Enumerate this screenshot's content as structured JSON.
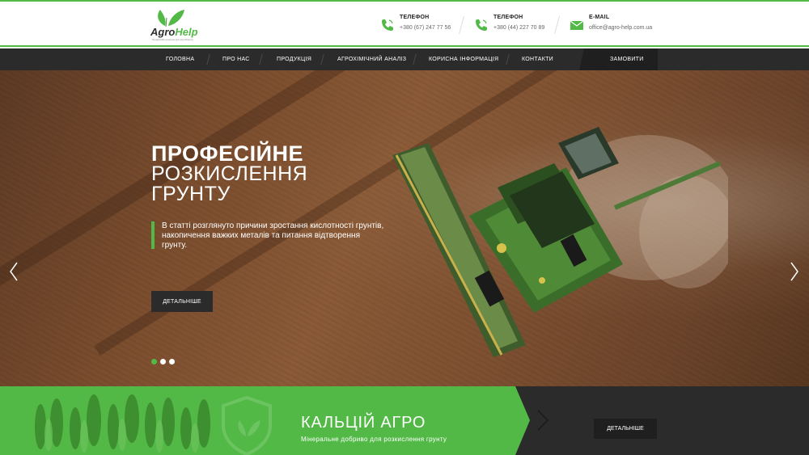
{
  "brand": {
    "name_part1": "Agro",
    "name_part2": "Help",
    "tagline": "Професійні рішення для агробізнесу"
  },
  "contacts": [
    {
      "label": "ТЕЛЕФОН",
      "value": "+380 (67) 247 77 56",
      "icon": "phone-icon"
    },
    {
      "label": "ТЕЛЕФОН",
      "value": "+380 (44) 227 70 89",
      "icon": "phone-icon"
    },
    {
      "label": "E-MAIL",
      "value": "office@agro-help.com.ua",
      "icon": "mail-icon"
    }
  ],
  "nav": {
    "items": [
      "ГОЛОВНА",
      "ПРО НАС",
      "ПРОДУКЦІЯ",
      "АГРОХІМІЧНИЙ АНАЛІЗ",
      "КОРИСНА ІНФОРМАЦІЯ",
      "КОНТАКТИ"
    ],
    "order_label": "ЗАМОВИТИ"
  },
  "hero": {
    "title_line1": "ПРОФЕСІЙНЕ",
    "title_line2": "РОЗКИСЛЕННЯ",
    "title_line3": "ГРУНТУ",
    "text": "В статті розглянуто причини зростання кислотності грунтів, накопичення важких металів та питання відтворення грунту.",
    "button_label": "ДЕТАЛЬНІШЕ",
    "slides_count": 3,
    "active_slide": 1
  },
  "banner": {
    "title": "КАЛЬЦІЙ АГРО",
    "subtitle": "Мінеральне добриво для розкислення грунту",
    "button_label": "ДЕТАЛЬНІШЕ"
  },
  "colors": {
    "accent": "#52b947",
    "dark": "#2b2b2b",
    "darker": "#1f1f1f"
  }
}
